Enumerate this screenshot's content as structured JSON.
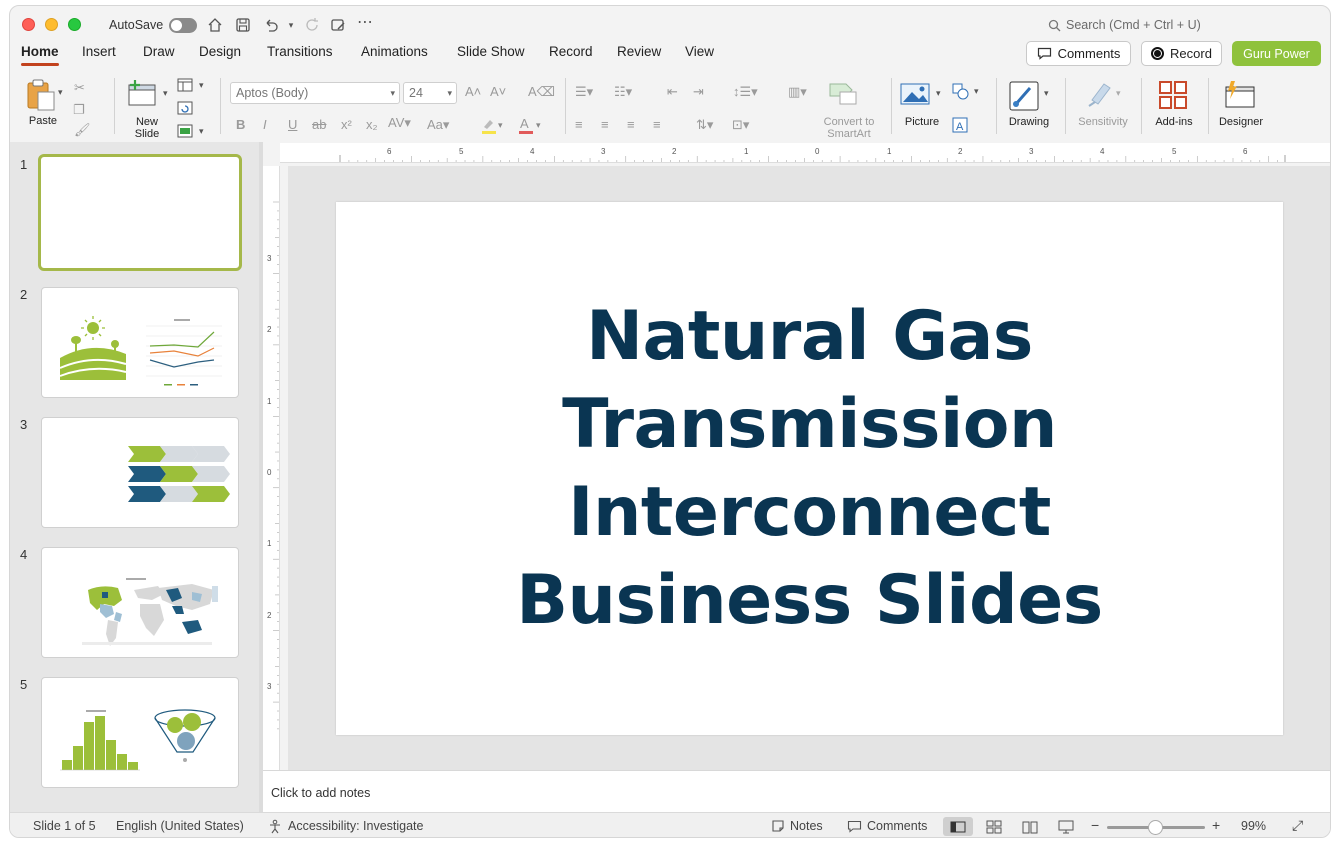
{
  "titlebar": {
    "autosave_label": "AutoSave",
    "search_placeholder": "Search (Cmd + Ctrl + U)"
  },
  "tabs": [
    {
      "label": "Home",
      "active": true
    },
    {
      "label": "Insert"
    },
    {
      "label": "Draw"
    },
    {
      "label": "Design"
    },
    {
      "label": "Transitions"
    },
    {
      "label": "Animations"
    },
    {
      "label": "Slide Show"
    },
    {
      "label": "Record"
    },
    {
      "label": "Review"
    },
    {
      "label": "View"
    }
  ],
  "header_buttons": {
    "comments": "Comments",
    "record": "Record",
    "guru": "Guru Power"
  },
  "ribbon": {
    "paste": "Paste",
    "new_slide": "New\nSlide",
    "font_name": "Aptos (Body)",
    "font_size": "24",
    "convert_smartart": "Convert to\nSmartArt",
    "picture": "Picture",
    "drawing": "Drawing",
    "sensitivity": "Sensitivity",
    "addins": "Add-ins",
    "designer": "Designer"
  },
  "thumbnails": [
    {
      "num": "1",
      "selected": true
    },
    {
      "num": "2"
    },
    {
      "num": "3"
    },
    {
      "num": "4",
      "chart_title": "Chart Title"
    },
    {
      "num": "5",
      "chart_title": "Chart Title"
    }
  ],
  "ruler": {
    "top": [
      "6",
      "5",
      "4",
      "3",
      "2",
      "1",
      "0",
      "1",
      "2",
      "3",
      "4",
      "5",
      "6"
    ],
    "left": [
      "3",
      "2",
      "1",
      "0",
      "1",
      "2",
      "3"
    ]
  },
  "slide": {
    "title": "Natural Gas Transmission Interconnect Business Slides"
  },
  "notes": {
    "placeholder": "Click to add notes"
  },
  "status": {
    "slide_info": "Slide 1 of 5",
    "language": "English (United States)",
    "accessibility": "Accessibility: Investigate",
    "notes": "Notes",
    "comments": "Comments",
    "zoom": "99%"
  },
  "colors": {
    "accent_tab": "#c2421e",
    "guru_green": "#8fc23c",
    "slide_title": "#0a3552",
    "thumb_green": "#9cbf3a",
    "thumb_navy": "#1f4e6e"
  }
}
